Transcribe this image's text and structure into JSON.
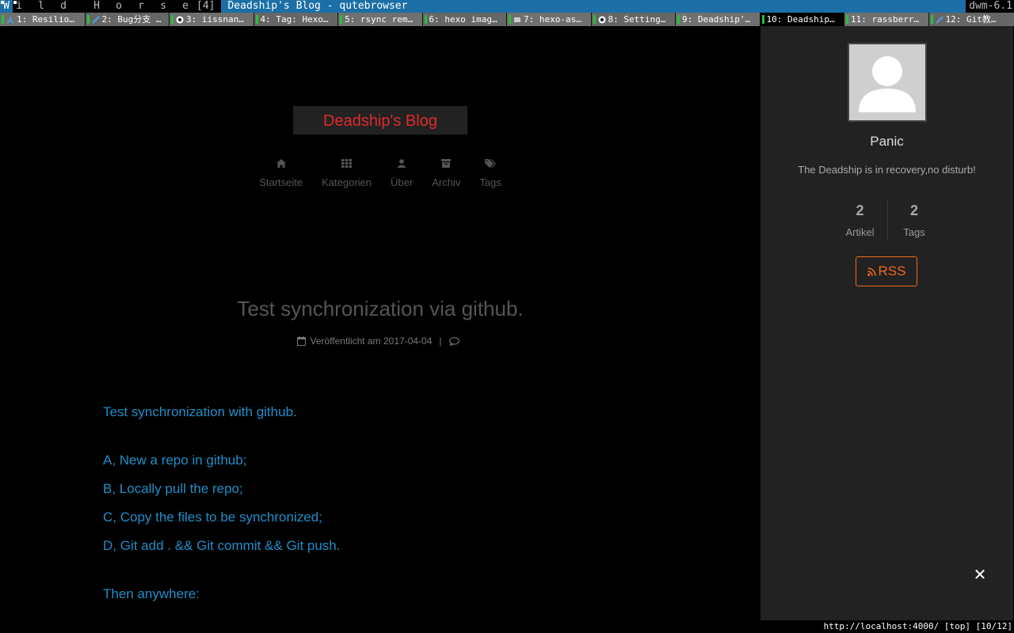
{
  "dwm": {
    "tags": [
      "W",
      "i",
      "l",
      "d",
      "H",
      "o",
      "r",
      "s",
      "e"
    ],
    "active_tag_index": 0,
    "layout_symbol": "[4]",
    "window_title": "Deadship's Blog - qutebrowser",
    "status_text": "dwm-6.1",
    "accent_color": "#1b6fa6"
  },
  "tabs": [
    {
      "label": "1: Resilio…",
      "icon": "resilio-icon"
    },
    {
      "label": "2: Bug分支 …",
      "icon": "quill-icon"
    },
    {
      "label": "3: iissnan…",
      "icon": "github-icon"
    },
    {
      "label": "4: Tag: Hexo…",
      "icon": ""
    },
    {
      "label": "5: rsync rem…",
      "icon": ""
    },
    {
      "label": "6: hexo imag…",
      "icon": ""
    },
    {
      "label": "7: hexo-as…",
      "icon": "flag-icon"
    },
    {
      "label": "8: Setting…",
      "icon": "github-icon"
    },
    {
      "label": "9: Deadship'…",
      "icon": ""
    },
    {
      "label": "10: Deadship…",
      "icon": "",
      "selected": true
    },
    {
      "label": "11: rassberr…",
      "icon": ""
    },
    {
      "label": "12: Git教…",
      "icon": "quill-icon"
    }
  ],
  "site": {
    "brand": "Deadship's Blog",
    "brand_color": "#e02a2a",
    "nav": [
      {
        "label": "Startseite",
        "icon": "home-icon"
      },
      {
        "label": "Kategorien",
        "icon": "grid-icon"
      },
      {
        "label": "Über",
        "icon": "user-icon"
      },
      {
        "label": "Archiv",
        "icon": "archive-icon"
      },
      {
        "label": "Tags",
        "icon": "tags-icon"
      }
    ]
  },
  "post": {
    "title": "Test synchronization via github.",
    "meta_label": "Veröffentlicht am",
    "date": "2017-04-04",
    "separator": "|",
    "link_color": "#1f8fc9",
    "paragraphs": [
      "Test synchronization with github.",
      "A, New a repo in github;",
      "B, Locally pull the repo;",
      "C, Copy the files to be synchronized;",
      "D, Git add . && Git commit && Git push.",
      "Then anywhere:"
    ]
  },
  "sidebar": {
    "author": "Panic",
    "description": "The Deadship is in recovery,no disturb!",
    "stats": [
      {
        "count": "2",
        "label": "Artikel"
      },
      {
        "count": "2",
        "label": "Tags"
      }
    ],
    "rss_label": "RSS",
    "rss_color": "#f06a1f"
  },
  "statusbar": {
    "url": "http://localhost:4000/",
    "scroll": "[top]",
    "tab_index": "[10/12]"
  }
}
